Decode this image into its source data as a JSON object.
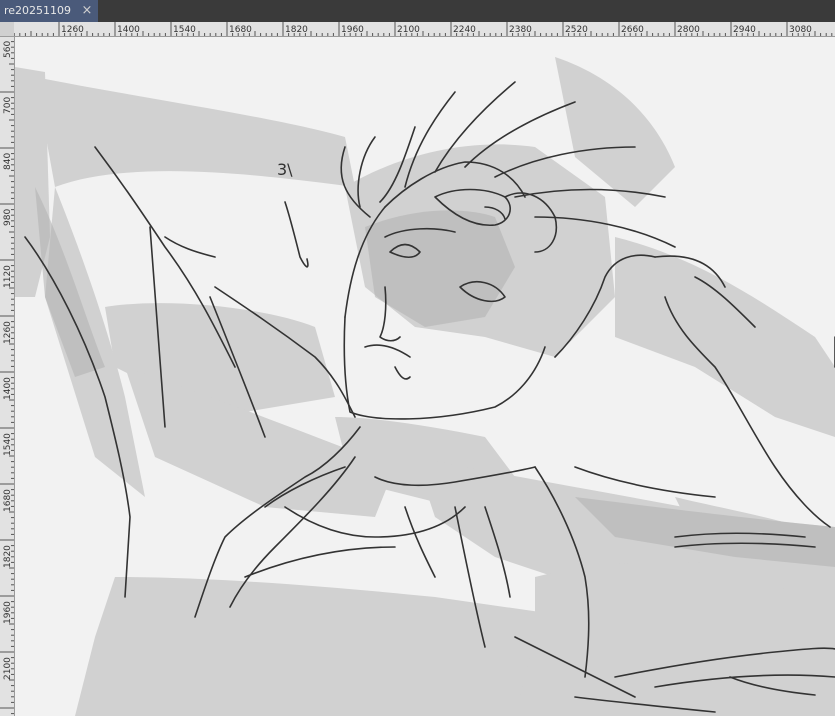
{
  "tab": {
    "title": "re20251109",
    "close_glyph": "×"
  },
  "ruler": {
    "horizontal_labels": [
      "1260",
      "1400",
      "1540",
      "1680",
      "1820",
      "1960",
      "2100",
      "2240",
      "2380",
      "2520",
      "2660",
      "2800",
      "2940",
      "3080"
    ],
    "vertical_labels": [
      "560",
      "700",
      "840",
      "980",
      "1120",
      "1260",
      "1400",
      "1540",
      "1680",
      "1820",
      "1960",
      "2100"
    ]
  },
  "canvas": {
    "annotation_text": "3\\",
    "background_color": "#f2f2f2",
    "stroke_color": "#333333",
    "shade_color": "#c8c8c8"
  },
  "icons": {
    "close": "close-icon"
  }
}
